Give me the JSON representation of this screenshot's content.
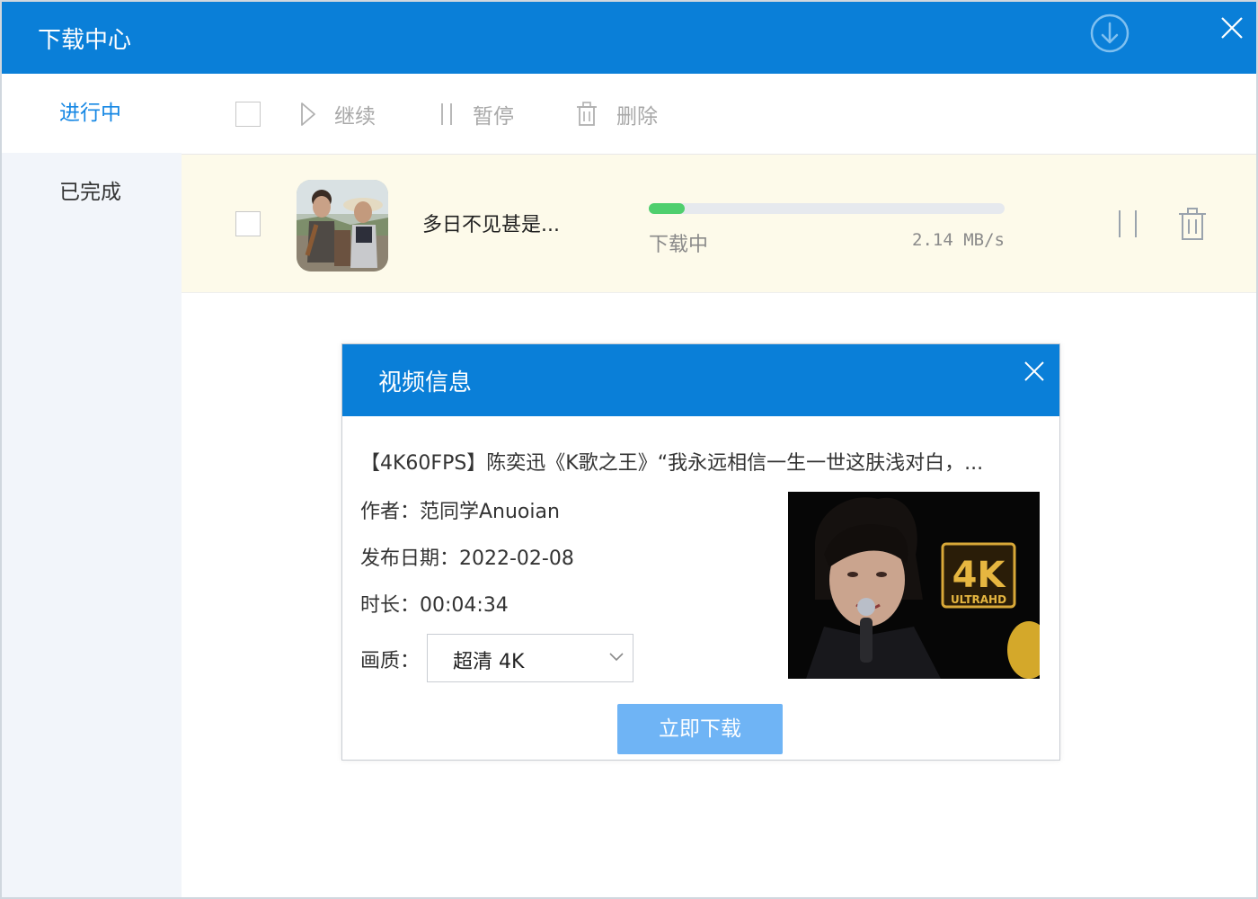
{
  "window": {
    "title": "下载中心",
    "download_icon": "download-circle-icon",
    "close_icon": "close-icon"
  },
  "sidebar": {
    "items": [
      {
        "label": "进行中",
        "active": true
      },
      {
        "label": "已完成",
        "active": false
      }
    ]
  },
  "toolbar": {
    "resume_label": "继续",
    "pause_label": "暂停",
    "delete_label": "删除"
  },
  "task": {
    "name": "多日不见甚是...",
    "status": "下载中",
    "speed": "2.14 MB/s",
    "progress_percent": 10
  },
  "dialog": {
    "title": "视频信息",
    "video_title": "【4K60FPS】陈奕迅《K歌之王》“我永远相信一生一世这肤浅对白，...",
    "author": "作者：范同学Anuoian",
    "publish_date": "发布日期：2022-02-08",
    "duration": "时长：00:04:34",
    "quality_label": "画质：",
    "quality_value": "超清 4K",
    "download_button": "立即下载",
    "badge_main": "4K",
    "badge_sub": "ULTRAHD"
  },
  "colors": {
    "accent": "#0a7fd8",
    "progress": "#4fcf6e",
    "row_highlight": "#fdfaea",
    "sidebar_bg": "#f2f5fa",
    "button_disabled": "#6fb4f5"
  }
}
